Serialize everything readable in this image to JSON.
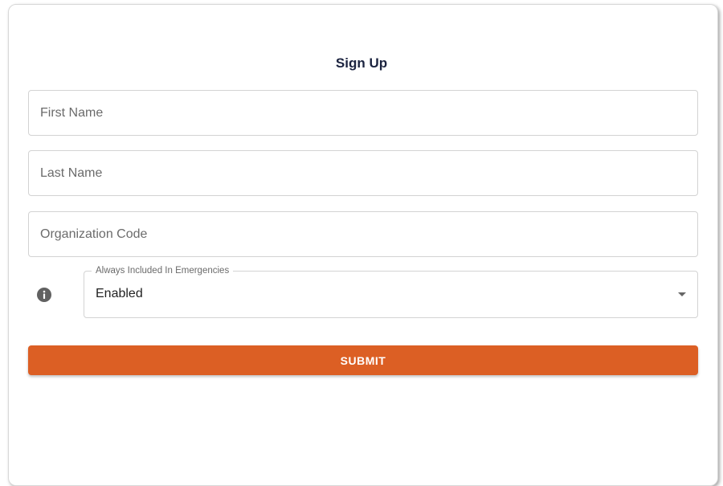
{
  "form": {
    "title": "Sign Up",
    "fields": [
      {
        "placeholder": "First Name",
        "value": ""
      },
      {
        "placeholder": "Last Name",
        "value": ""
      },
      {
        "placeholder": "Organization Code",
        "value": ""
      }
    ],
    "emergency_select": {
      "label": "Always Included In Emergencies",
      "value": "Enabled",
      "info_icon": "info-icon",
      "dropdown_icon": "chevron-down-icon"
    },
    "submit_label": "SUBMIT"
  },
  "colors": {
    "accent": "#DC5F24",
    "title_text": "#1C2440",
    "icon": "#616161"
  }
}
